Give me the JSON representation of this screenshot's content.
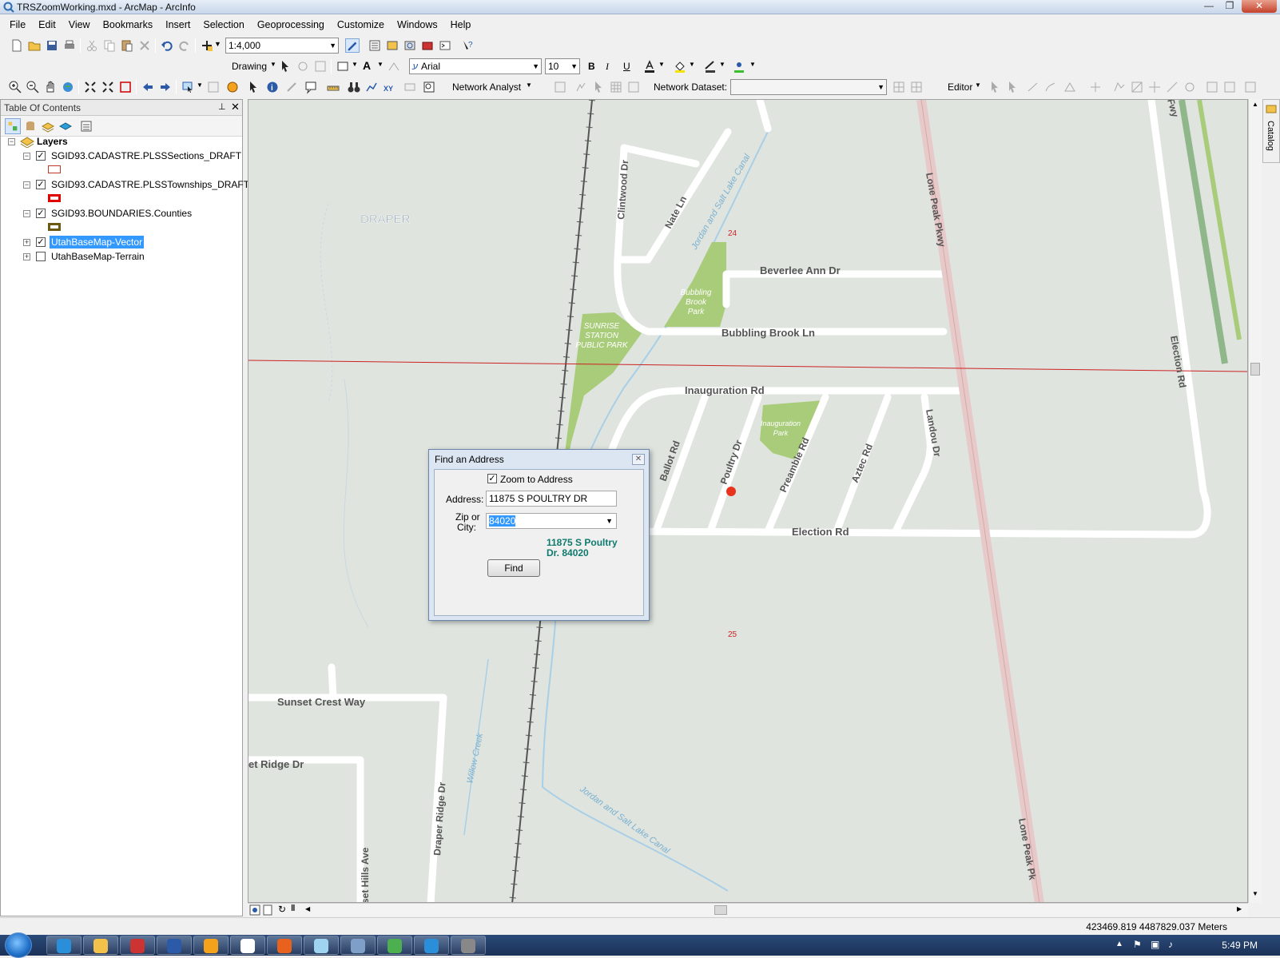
{
  "window": {
    "title": "TRSZoomWorking.mxd - ArcMap - ArcInfo"
  },
  "menu": [
    "File",
    "Edit",
    "View",
    "Bookmarks",
    "Insert",
    "Selection",
    "Geoprocessing",
    "Customize",
    "Windows",
    "Help"
  ],
  "standard_toolbar": {
    "scale": "1:4,000"
  },
  "drawing_toolbar": {
    "drawing_label": "Drawing",
    "font": "Arial",
    "font_size": "10",
    "bold": "B",
    "italic": "I",
    "underline": "U",
    "text_tool": "A"
  },
  "tools_toolbar": {
    "network_analyst": "Network Analyst",
    "network_dataset_label": "Network Dataset:",
    "editor": "Editor"
  },
  "toc": {
    "title": "Table Of Contents",
    "root": "Layers",
    "layers": [
      {
        "name": "SGID93.CADASTRE.PLSSSections_DRAFT",
        "checked": true,
        "expanded": true,
        "symbol_color": "#c0392b"
      },
      {
        "name": "SGID93.CADASTRE.PLSSTownships_DRAFT",
        "checked": true,
        "expanded": true,
        "symbol_color": "#e00000"
      },
      {
        "name": "SGID93.BOUNDARIES.Counties",
        "checked": true,
        "expanded": true,
        "symbol_color": "#6b5a10"
      },
      {
        "name": "UtahBaseMap-Vector",
        "checked": true,
        "expanded": false,
        "selected": true
      },
      {
        "name": "UtahBaseMap-Terrain",
        "checked": false,
        "expanded": false
      }
    ]
  },
  "map": {
    "labels": {
      "draper": "DRAPER",
      "clintwood": "Clintwood Dr",
      "nate": "Nate Ln",
      "canal_top": "Jordan and Salt Lake Canal",
      "canal_bottom": "Jordan and Salt Lake Canal",
      "section_24": "24",
      "section_25": "25",
      "beverlee": "Beverlee Ann Dr",
      "bubbling_park": [
        "Bubbling",
        "Brook",
        "Park"
      ],
      "bubbling_ln": "Bubbling Brook Ln",
      "sunrise_park": [
        "SUNRISE",
        "STATION",
        "PUBLIC PARK"
      ],
      "inauguration_rd": "Inauguration Rd",
      "inauguration_park": [
        "Inauguration",
        "Park"
      ],
      "ballot": "Ballot Rd",
      "poultry": "Poultry Dr",
      "preamble": "Preamble Rd",
      "aztec": "Aztec Rd",
      "landou": "Landou Dr",
      "election_rd": "Election Rd",
      "election_rd_v": "Election Rd",
      "lone_peak_top": "Lone Peak Pkwy",
      "lone_peak_bottom": "Lone Peak Pk",
      "fwy": "Fwy",
      "sunset_crest": "Sunset Crest Way",
      "ridge_dr": "et Ridge Dr",
      "draper_ridge": "Draper Ridge Dr",
      "willow_creek": "Willow Creek",
      "hills_ave": "set Hills Ave"
    },
    "colors": {
      "background": "#dfe4df",
      "road": "#ffffff",
      "park": "#a9cc7a",
      "highway": "#e7c9c9",
      "canal": "#a9cfe6",
      "section_line": "#cc2222",
      "point": "#e8321e"
    }
  },
  "dialog": {
    "title": "Find an Address",
    "zoom_label": "Zoom to Address",
    "zoom_checked": true,
    "address_label": "Address:",
    "address_value": "11875  S  POULTRY  DR",
    "zip_label_1": "Zip or",
    "zip_label_2": "City:",
    "zip_value": "84020",
    "result_line1": "11875 S Poultry",
    "result_line2": "Dr. 84020",
    "find_label": "Find"
  },
  "catalog_tab": "Catalog",
  "status": {
    "coordinates": "423469.819  4487829.037 Meters"
  },
  "taskbar": {
    "clock": "5:49 PM"
  }
}
